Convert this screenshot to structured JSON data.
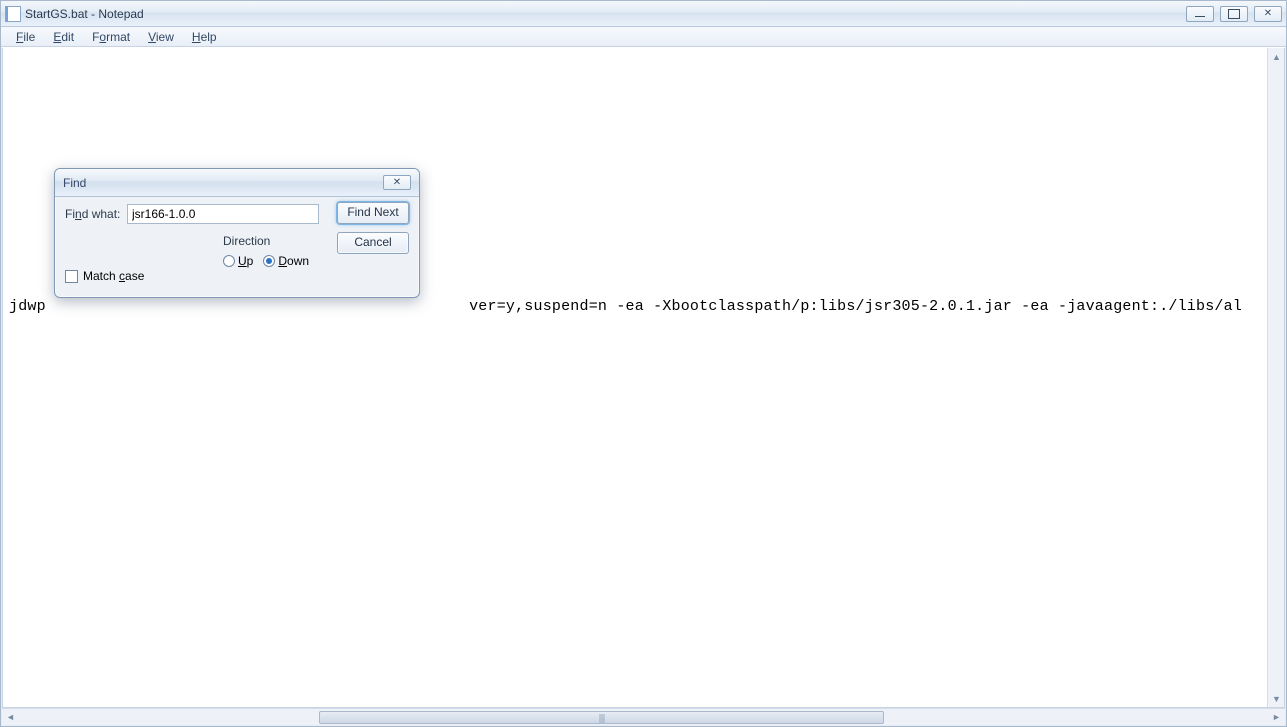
{
  "window": {
    "title": "StartGS.bat - Notepad"
  },
  "menu": {
    "file": "File",
    "edit": "Edit",
    "format": "Format",
    "view": "View",
    "help": "Help"
  },
  "editor": {
    "visible_line_prefix": "jdwp",
    "visible_line_suffix": "ver=y,suspend=n -ea -Xbootclasspath/p:libs/jsr305-2.0.1.jar -ea -javaagent:./libs/al"
  },
  "find": {
    "title": "Find",
    "find_what_label": "Find what:",
    "find_what_value": "jsr166-1.0.0",
    "find_next": "Find Next",
    "cancel": "Cancel",
    "direction_label": "Direction",
    "up": "Up",
    "down": "Down",
    "selected_direction": "down",
    "match_case": "Match case",
    "match_case_checked": false
  }
}
